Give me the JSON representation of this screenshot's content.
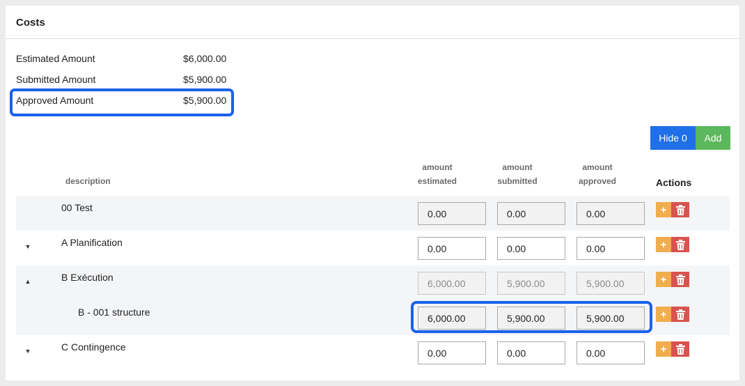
{
  "panel": {
    "title": "Costs"
  },
  "summary": [
    {
      "label": "Estimated Amount",
      "value": "$6,000.00"
    },
    {
      "label": "Submitted Amount",
      "value": "$5,900.00"
    },
    {
      "label": "Approved Amount",
      "value": "$5,900.00"
    }
  ],
  "toolbar": {
    "hide_label": "Hide 0",
    "add_label": "Add"
  },
  "table": {
    "headers": {
      "description": "description",
      "estimated": [
        "amount",
        "estimated"
      ],
      "submitted": [
        "amount",
        "submitted"
      ],
      "approved": [
        "amount",
        "approved"
      ],
      "actions": "Actions"
    },
    "rows": [
      {
        "description": "00 Test",
        "estimated": "0.00",
        "submitted": "0.00",
        "approved": "0.00"
      },
      {
        "description": "A Planification",
        "estimated": "0.00",
        "submitted": "0.00",
        "approved": "0.00"
      },
      {
        "description": "B Exécution",
        "estimated": "6,000.00",
        "submitted": "5,900.00",
        "approved": "5,900.00"
      },
      {
        "description": "B - 001 structure",
        "estimated": "6,000.00",
        "submitted": "5,900.00",
        "approved": "5,900.00"
      },
      {
        "description": "C Contingence",
        "estimated": "0.00",
        "submitted": "0.00",
        "approved": "0.00"
      }
    ]
  },
  "colors": {
    "primary": "#1f6fe8",
    "success": "#5cb85c",
    "warning": "#f0ad4e",
    "danger": "#d9534f",
    "highlight": "#1a62e8"
  }
}
